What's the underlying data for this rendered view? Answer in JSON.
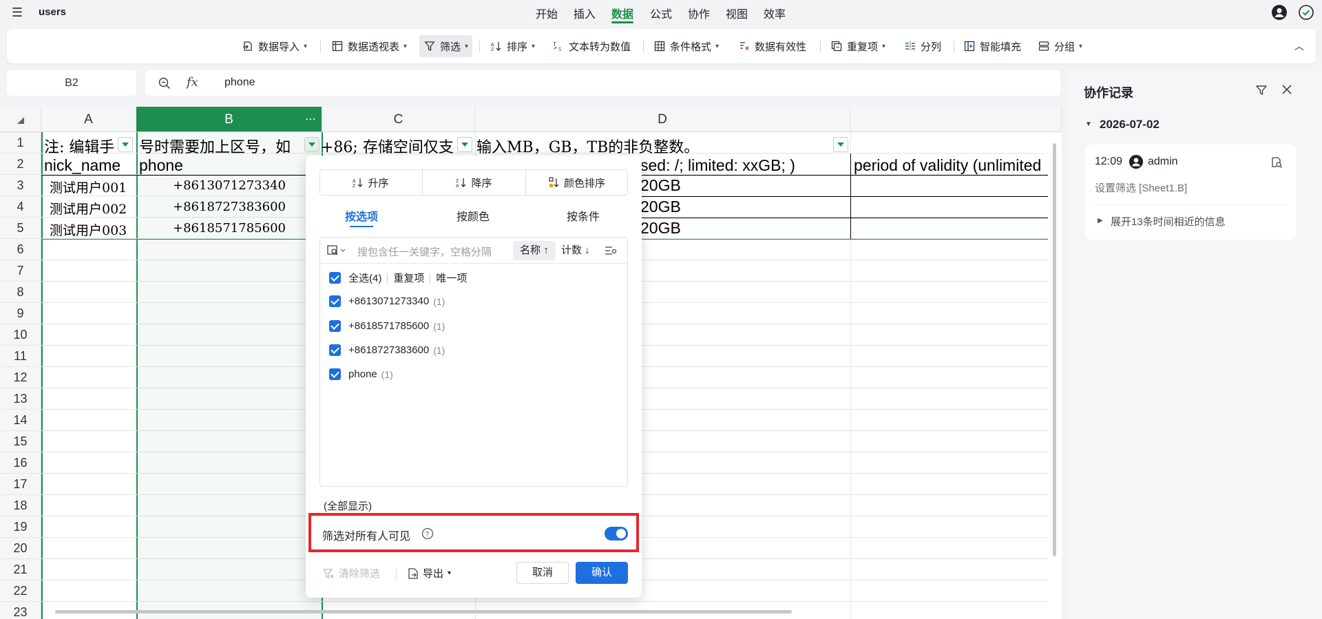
{
  "app": {
    "title": "users"
  },
  "menu_tabs": [
    "开始",
    "插入",
    "数据",
    "公式",
    "协作",
    "视图",
    "效率"
  ],
  "active_tab": "数据",
  "ribbon": {
    "import": "数据导入",
    "pivot": "数据透视表",
    "filter": "筛选",
    "sort": "排序",
    "text_to_number": "文本转为数值",
    "conditional_format": "条件格式",
    "validation": "数据有效性",
    "duplicates": "重复项",
    "split": "分列",
    "smart_fill": "智能填充",
    "group": "分组"
  },
  "formula_bar": {
    "name_box": "B2",
    "fx": "fx",
    "value": "phone"
  },
  "grid": {
    "columns": [
      "A",
      "B",
      "C",
      "D"
    ],
    "selected_column": "B",
    "rows": [
      "1",
      "2",
      "3",
      "4",
      "5",
      "6",
      "7",
      "8",
      "9",
      "10",
      "11",
      "12",
      "13",
      "14",
      "15",
      "16",
      "17",
      "18",
      "19",
      "20",
      "21",
      "22",
      "23"
    ],
    "row1": {
      "a": "注: 编辑手",
      "b": "号时需要加上区号，如",
      "c": "+86; 存储空间仅支",
      "d": "输入MB，GB，TB的非负整数。"
    },
    "row2": {
      "a": "nick_name",
      "b": "phone",
      "d": "sed: /; limited: xxGB; )",
      "e": "period of validity (unlimited"
    },
    "data_rows": [
      {
        "nick_name": "测试用户001",
        "phone": "+8613071273340",
        "storage": "20GB"
      },
      {
        "nick_name": "测试用户002",
        "phone": "+8618727383600",
        "storage": "20GB"
      },
      {
        "nick_name": "测试用户003",
        "phone": "+8618571785600",
        "storage": "20GB"
      }
    ]
  },
  "filter_dialog": {
    "sort_asc": "升序",
    "sort_desc": "降序",
    "sort_color": "颜色排序",
    "tabs": [
      "按选项",
      "按颜色",
      "按条件"
    ],
    "active_tab": "按选项",
    "search_placeholder": "搜包含任一关键字，空格分隔",
    "sort_name": "名称",
    "sort_count": "计数",
    "select_all": "全选(4)",
    "duplicates": "重复项",
    "unique": "唯一项",
    "items": [
      {
        "label": "+8613071273340",
        "count": "(1)",
        "checked": true
      },
      {
        "label": "+8618571785600",
        "count": "(1)",
        "checked": true
      },
      {
        "label": "+8618727383600",
        "count": "(1)",
        "checked": true
      },
      {
        "label": "phone",
        "count": "(1)",
        "checked": true
      }
    ],
    "status": "(全部显示)",
    "visible_label": "筛选对所有人可见",
    "visible_on": true,
    "clear": "清除筛选",
    "export": "导出",
    "cancel": "取消",
    "confirm": "确认"
  },
  "side_panel": {
    "title": "协作记录",
    "date": "2026-07-02",
    "time": "12:09",
    "user": "admin",
    "action": "设置筛选 [Sheet1.B]",
    "expand": "展开13条时间相近的信息"
  },
  "colors": {
    "accent": "#1e8e50",
    "primary": "#1e6fe0",
    "highlight_box": "#e8262d"
  }
}
